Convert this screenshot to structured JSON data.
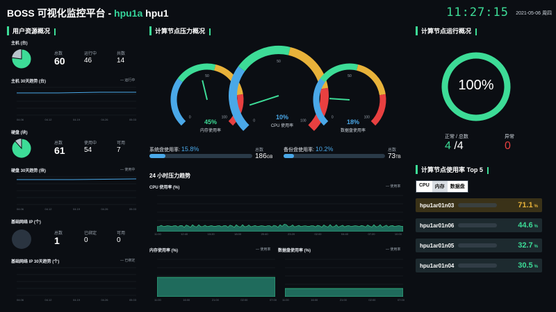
{
  "header": {
    "title": "BOSS 可视化监控平台 - ",
    "cluster": "hpu1a",
    "name": "hpu1",
    "time": "11:27:15",
    "date": "2021-05-06 周四"
  },
  "resource": {
    "section_title": "用户资源概况",
    "host": {
      "title": "主机 (台)",
      "labels": [
        "总数",
        "运行中",
        "共数"
      ],
      "values": [
        "60",
        "46",
        "14"
      ],
      "ratio": 0.77
    },
    "host_trend": {
      "title": "主机 30天趋势 (台)",
      "legend": "运行中",
      "ticks": [
        "04.06",
        "04.12",
        "04.19",
        "04.26",
        "05.03"
      ]
    },
    "disk": {
      "title": "硬盘 (块)",
      "labels": [
        "总数",
        "使用中",
        "可用"
      ],
      "values": [
        "61",
        "54",
        "7"
      ],
      "ratio": 0.885
    },
    "disk_trend": {
      "title": "硬盘 30天趋势 (块)",
      "legend": "使用中",
      "ticks": [
        "04.06",
        "04.12",
        "04.19",
        "04.26",
        "05.03"
      ]
    },
    "ip": {
      "title": "基础网络 IP (个)",
      "labels": [
        "总数",
        "已绑定",
        "可用"
      ],
      "values": [
        "1",
        "0",
        "0"
      ],
      "ratio": 0
    },
    "ip_trend": {
      "title": "基础网络 IP 30天趋势 (个)",
      "legend": "已绑定",
      "ticks": [
        "04.06",
        "04.12",
        "04.19",
        "04.26",
        "05.03"
      ]
    }
  },
  "pressure": {
    "section_title": "计算节点压力概况",
    "gauges": [
      {
        "value": "45%",
        "label": "内存使用率",
        "max": "100",
        "min": "0",
        "mid": "50",
        "frac": 0.45
      },
      {
        "value": "10%",
        "label": "CPU 使用率",
        "max": "100",
        "min": "0",
        "mid": "50",
        "frac": 0.1
      },
      {
        "value": "18%",
        "label": "数据盘使用率",
        "max": "100",
        "min": "0",
        "mid": "50",
        "frac": 0.18
      }
    ],
    "sys_disk": {
      "label": "系统盘使用率:",
      "pct": "15.8%",
      "total_label": "总数",
      "total": "186",
      "unit": "GB",
      "frac": 0.158
    },
    "backup_disk": {
      "label": "备份盘使用率:",
      "pct": "10.2%",
      "total_label": "总数",
      "total": "73",
      "unit": "TB",
      "frac": 0.102
    },
    "trend_title": "24 小时压力趋势",
    "cpu_chart": {
      "title": "CPU 使用率 (%)",
      "legend": "使用率",
      "ticks": [
        "11:00",
        "12:40",
        "15:20",
        "18:00",
        "20:40",
        "23:20",
        "02:00",
        "04:40",
        "07:20",
        "10:00"
      ]
    },
    "mem_chart": {
      "title": "内存使用率 (%)",
      "legend": "使用率",
      "ticks": [
        "11:00",
        "16:00",
        "21:00",
        "02:00",
        "07:00"
      ]
    },
    "data_chart": {
      "title": "数据盘使用率 (%)",
      "legend": "使用率",
      "ticks": [
        "11:00",
        "16:00",
        "21:00",
        "02:00",
        "07:00"
      ]
    }
  },
  "running": {
    "section_title": "计算节点运行概况",
    "percent": "100%",
    "normal_label": "正常 / 总数",
    "normal": "4",
    "total": "4",
    "abnormal_label": "异常",
    "abnormal": "0"
  },
  "top5": {
    "section_title": "计算节点使用率 Top 5",
    "tabs": [
      "CPU",
      "内存",
      "数据盘"
    ],
    "rows": [
      {
        "name": "hpu1ar01n03",
        "value": "71.1",
        "unit": "%"
      },
      {
        "name": "hpu1ar01n06",
        "value": "44.6",
        "unit": "%"
      },
      {
        "name": "hpu1ar01n05",
        "value": "32.7",
        "unit": "%"
      },
      {
        "name": "hpu1ar01n04",
        "value": "30.5",
        "unit": "%"
      }
    ]
  },
  "colors": {
    "accent": "#3ddc97",
    "blue": "#4aa8e8",
    "warn": "#e8b23a",
    "danger": "#e84040"
  }
}
